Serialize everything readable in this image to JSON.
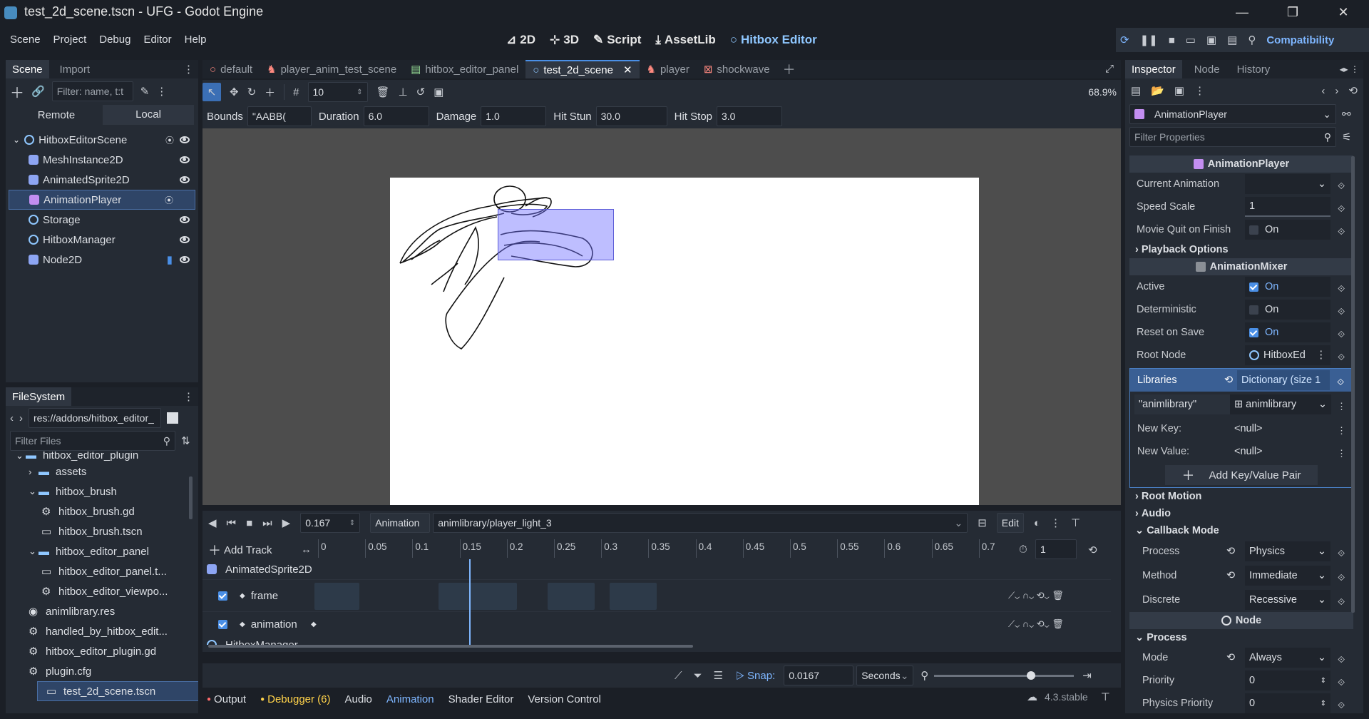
{
  "window": {
    "title": "test_2d_scene.tscn - UFG - Godot Engine"
  },
  "menu": {
    "items": [
      "Scene",
      "Project",
      "Debug",
      "Editor",
      "Help"
    ]
  },
  "workspaces": [
    {
      "label": "2D",
      "icon": "2d-icon"
    },
    {
      "label": "3D",
      "icon": "3d-icon"
    },
    {
      "label": "Script",
      "icon": "script-icon"
    },
    {
      "label": "AssetLib",
      "icon": "assetlib-icon"
    },
    {
      "label": "Hitbox Editor",
      "icon": "hitbox-icon"
    }
  ],
  "renderer": "Compatibility",
  "scene_dock": {
    "tabs": [
      "Scene",
      "Import"
    ],
    "filter_placeholder": "Filter: name, t:t",
    "remote": "Remote",
    "local": "Local",
    "nodes": [
      {
        "name": "HitboxEditorScene",
        "indent": 0,
        "color": "#8fc7ff"
      },
      {
        "name": "MeshInstance2D",
        "indent": 1,
        "color": "#8da5f3"
      },
      {
        "name": "AnimatedSprite2D",
        "indent": 1,
        "color": "#8da5f3"
      },
      {
        "name": "AnimationPlayer",
        "indent": 1,
        "color": "#c38ef1",
        "selected": true
      },
      {
        "name": "Storage",
        "indent": 1,
        "color": "#8fc7ff"
      },
      {
        "name": "HitboxManager",
        "indent": 1,
        "color": "#8fc7ff"
      },
      {
        "name": "Node2D",
        "indent": 1,
        "color": "#8da5f3"
      }
    ]
  },
  "filesystem": {
    "title": "FileSystem",
    "path": "res://addons/hitbox_editor_",
    "filter_placeholder": "Filter Files",
    "items": [
      {
        "name": "hitbox_editor_plugin",
        "indent": 1,
        "type": "folder"
      },
      {
        "name": "assets",
        "indent": 2,
        "type": "folder",
        "collapsed": true
      },
      {
        "name": "hitbox_brush",
        "indent": 2,
        "type": "folder"
      },
      {
        "name": "hitbox_brush.gd",
        "indent": 3,
        "type": "gear"
      },
      {
        "name": "hitbox_brush.tscn",
        "indent": 3,
        "type": "scene"
      },
      {
        "name": "hitbox_editor_panel",
        "indent": 2,
        "type": "folder"
      },
      {
        "name": "hitbox_editor_panel.t...",
        "indent": 3,
        "type": "scene"
      },
      {
        "name": "hitbox_editor_viewpo...",
        "indent": 3,
        "type": "gear"
      },
      {
        "name": "animlibrary.res",
        "indent": 2,
        "type": "res"
      },
      {
        "name": "handled_by_hitbox_edit...",
        "indent": 2,
        "type": "gear"
      },
      {
        "name": "hitbox_editor_plugin.gd",
        "indent": 2,
        "type": "gear"
      },
      {
        "name": "plugin.cfg",
        "indent": 2,
        "type": "cfg"
      },
      {
        "name": "test_2d_scene.tscn",
        "indent": 2,
        "type": "scene",
        "selected": true
      }
    ]
  },
  "scene_tabs": [
    {
      "label": "default",
      "icon": "circle"
    },
    {
      "label": "player_anim_test_scene",
      "icon": "person"
    },
    {
      "label": "hitbox_editor_panel",
      "icon": "panel"
    },
    {
      "label": "test_2d_scene",
      "icon": "circle",
      "active": true
    },
    {
      "label": "player",
      "icon": "person"
    },
    {
      "label": "shockwave",
      "icon": "node"
    }
  ],
  "toolbar": {
    "grid_step": "10",
    "zoom": "68.9%"
  },
  "hitbox_fields": [
    {
      "label": "Bounds",
      "value": "\"AABB("
    },
    {
      "label": "Duration",
      "value": "6.0"
    },
    {
      "label": "Damage",
      "value": "1.0"
    },
    {
      "label": "Hit Stun",
      "value": "30.0"
    },
    {
      "label": "Hit Stop",
      "value": "3.0"
    }
  ],
  "animation": {
    "time": "0.167",
    "label": "Animation",
    "current": "animlibrary/player_light_3",
    "edit": "Edit",
    "add_track": "Add Track",
    "ticks": [
      "0",
      "0.05",
      "0.1",
      "0.15",
      "0.2",
      "0.25",
      "0.3",
      "0.35",
      "0.4",
      "0.45",
      "0.5",
      "0.55",
      "0.6",
      "0.65",
      "0.7"
    ],
    "length": "1",
    "tracks": [
      {
        "name": "AnimatedSprite2D",
        "type": "header"
      },
      {
        "name": "frame",
        "type": "track"
      },
      {
        "name": "animation",
        "type": "track"
      },
      {
        "name": "HitboxManager",
        "type": "header"
      }
    ],
    "snap_label": "Snap:",
    "snap": "0.0167",
    "units": "Seconds"
  },
  "bottom_tabs": [
    "Output",
    "Debugger (6)",
    "Audio",
    "Animation",
    "Shader Editor",
    "Version Control"
  ],
  "version": "4.3.stable",
  "inspector": {
    "tabs": [
      "Inspector",
      "Node",
      "History"
    ],
    "object": "AnimationPlayer",
    "filter_placeholder": "Filter Properties",
    "sec_player": "AnimationPlayer",
    "current_animation": "Current Animation",
    "speed_scale": "Speed Scale",
    "speed_value": "1",
    "movie_quit": "Movie Quit on Finish",
    "on": "On",
    "playback_options": "Playback Options",
    "sec_mixer": "AnimationMixer",
    "active": "Active",
    "deterministic": "Deterministic",
    "reset_on_save": "Reset on Save",
    "root_node": "Root Node",
    "root_node_value": "HitboxEd",
    "libraries": "Libraries",
    "libraries_value": "Dictionary (size 1",
    "lib_key": "\"animlibrary\"",
    "lib_val": "animlibrary",
    "new_key": "New Key:",
    "new_value": "New Value:",
    "null": "<null>",
    "add_pair": "Add Key/Value Pair",
    "root_motion": "Root Motion",
    "audio": "Audio",
    "callback_mode": "Callback Mode",
    "process": "Process",
    "process_value": "Physics",
    "method": "Method",
    "method_value": "Immediate",
    "discrete": "Discrete",
    "discrete_value": "Recessive",
    "sec_node": "Node",
    "process_sec": "Process",
    "mode": "Mode",
    "mode_value": "Always",
    "priority": "Priority",
    "priority_value": "0",
    "physics_priority": "Physics Priority",
    "physics_priority_value": "0"
  }
}
